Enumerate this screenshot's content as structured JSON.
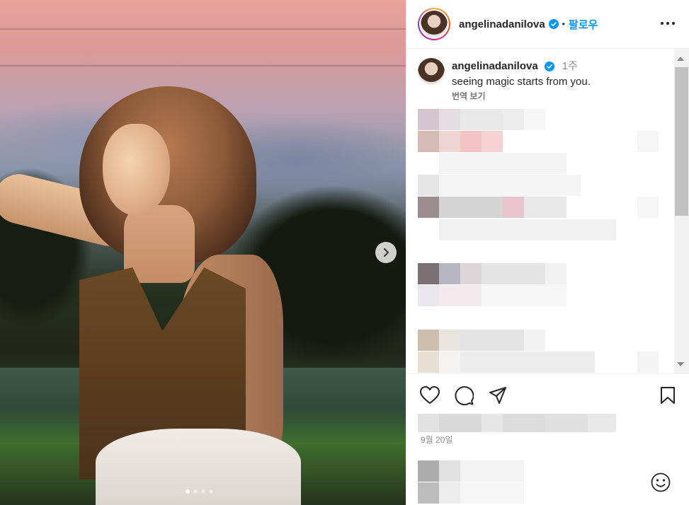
{
  "header": {
    "username": "angelinadanilova",
    "separator": "•",
    "follow_label": "팔로우"
  },
  "caption": {
    "username": "angelinadanilova",
    "time_ago": "1주",
    "text": "seeing magic starts from you.",
    "translate_label": "번역 보기"
  },
  "post": {
    "date": "9월 20일",
    "carousel": {
      "total_slides": 4,
      "active_slide": 1
    }
  },
  "icons": {
    "verified": "verified-badge-icon",
    "more": "more-options-icon",
    "like": "heart-icon",
    "comment": "comment-icon",
    "share": "share-icon",
    "save": "bookmark-icon",
    "emoji": "emoji-icon",
    "next": "chevron-right-icon"
  },
  "colors": {
    "accent": "#0095f6",
    "verified": "#0095f6",
    "text": "#262626",
    "muted": "#8e8e8e"
  }
}
